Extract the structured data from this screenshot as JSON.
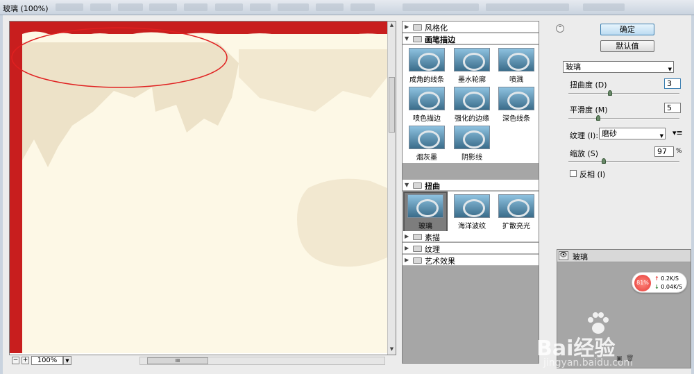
{
  "window": {
    "title": "玻璃 (100%)"
  },
  "preview": {
    "zoom": "100%",
    "zoom_out": "−",
    "zoom_in": "+",
    "scroll_grip": "III"
  },
  "filters": {
    "categories": [
      {
        "label": "风格化",
        "open": false
      },
      {
        "label": "画笔描边",
        "open": true,
        "items": [
          "成角的线条",
          "墨水轮廓",
          "喷溅",
          "喷色描边",
          "强化的边缘",
          "深色线条",
          "烟灰墨",
          "阴影线"
        ]
      },
      {
        "label": "扭曲",
        "open": true,
        "items": [
          "玻璃",
          "海洋波纹",
          "扩散亮光"
        ],
        "selected": "玻璃"
      },
      {
        "label": "素描",
        "open": false
      },
      {
        "label": "纹理",
        "open": false
      },
      {
        "label": "艺术效果",
        "open": false
      }
    ]
  },
  "right": {
    "collapse_icon": "chevron-up-icon",
    "ok_label": "确定",
    "default_label": "默认值",
    "filter_select": "玻璃",
    "params": {
      "distortion": {
        "label": "扭曲度 (D)",
        "value": "3",
        "level": 0.3
      },
      "smoothness": {
        "label": "平滑度 (M)",
        "value": "5",
        "level": 0.33
      },
      "texture": {
        "label": "纹理 (I):",
        "value": "磨砂"
      },
      "scaling": {
        "label": "缩放 (S)",
        "value": "97",
        "unit": "%",
        "level": 0.25
      },
      "invert": {
        "label": "反相 (I)",
        "checked": false
      }
    },
    "layer": {
      "name": "玻璃"
    },
    "speed": {
      "percent": "81%",
      "up": "0.2K/S",
      "down": "0.04K/S"
    },
    "watermark": {
      "brand": "Bai经验",
      "url": "jingyan.baidu.com"
    }
  }
}
